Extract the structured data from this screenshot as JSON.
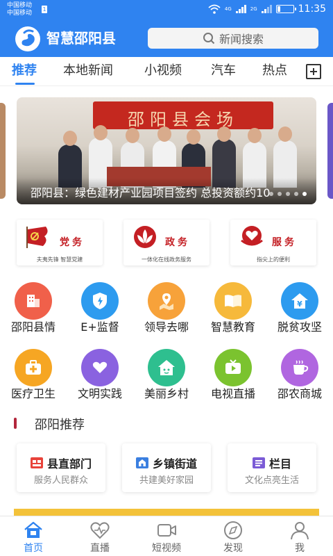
{
  "status_bar": {
    "carrier_1": "中国移动",
    "carrier_2": "中国移动",
    "sim_badge": "1",
    "network_1": "4G",
    "network_2": "2G",
    "time": "11:35",
    "battery_level": 0.2
  },
  "header": {
    "app_title": "智慧邵阳县",
    "search_placeholder": "新闻搜索"
  },
  "tabs": {
    "items": [
      "推荐",
      "本地新闻",
      "小视频",
      "汽车",
      "热点"
    ],
    "active_index": 0
  },
  "banner": {
    "sign_text": "邵阳县会场",
    "caption": "邵阳县：绿色建材产业园项目签约 总投资额约10",
    "slide_count": 5,
    "active_slide": 4
  },
  "service_cards": [
    {
      "title": "党务",
      "subtitle": "夫夷先锋  智慧党建",
      "color": "#c41f24"
    },
    {
      "title": "政务",
      "subtitle": "一体化在线政务服务",
      "color": "#c41f24"
    },
    {
      "title": "服务",
      "subtitle": "指尖上的便利",
      "color": "#c41f24"
    }
  ],
  "grid_items": [
    {
      "label": "邵阳县情",
      "icon": "building-icon",
      "color": "#f0604a"
    },
    {
      "label": "E+监督",
      "icon": "shield-icon",
      "color": "#2d9bef"
    },
    {
      "label": "领导去哪",
      "icon": "location-icon",
      "color": "#f7a23a"
    },
    {
      "label": "智慧教育",
      "icon": "book-icon",
      "color": "#f6b93b"
    },
    {
      "label": "脱贫攻坚",
      "icon": "house-yen-icon",
      "color": "#2d9bef"
    },
    {
      "label": "医疗卫生",
      "icon": "medical-kit-icon",
      "color": "#f6a623"
    },
    {
      "label": "文明实践",
      "icon": "heart-hands-icon",
      "color": "#8a62e0"
    },
    {
      "label": "美丽乡村",
      "icon": "village-icon",
      "color": "#2ebf8f"
    },
    {
      "label": "电视直播",
      "icon": "tv-icon",
      "color": "#7bc32f"
    },
    {
      "label": "邵农商城",
      "icon": "cup-icon",
      "color": "#b066e0"
    }
  ],
  "section": {
    "title": "邵阳推荐"
  },
  "recommend_cards": [
    {
      "title": "县直部门",
      "subtitle": "服务人民群众",
      "icon": "department-icon",
      "color": "#e8433a"
    },
    {
      "title": "乡镇街道",
      "subtitle": "共建美好家园",
      "icon": "town-icon",
      "color": "#3b7fe0"
    },
    {
      "title": "栏目",
      "subtitle": "文化点亮生活",
      "icon": "column-icon",
      "color": "#7b5bd6"
    }
  ],
  "bottom_nav": {
    "items": [
      {
        "label": "首页",
        "icon": "home-icon"
      },
      {
        "label": "直播",
        "icon": "heart-live-icon"
      },
      {
        "label": "短视频",
        "icon": "video-camera-icon"
      },
      {
        "label": "发现",
        "icon": "compass-icon"
      },
      {
        "label": "我",
        "icon": "person-icon"
      }
    ],
    "active_index": 0,
    "active_color": "#2f83f0"
  }
}
